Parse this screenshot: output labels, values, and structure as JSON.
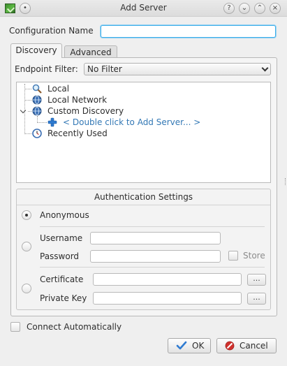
{
  "window": {
    "title": "Add Server",
    "help_symbol": "?",
    "minimize_symbol": "⌄",
    "maximize_symbol": "⌃",
    "close_symbol": "×",
    "pin_symbol": "•"
  },
  "config": {
    "label": "Configuration Name",
    "value": ""
  },
  "tabs": [
    {
      "label": "Discovery",
      "active": true
    },
    {
      "label": "Advanced",
      "active": false
    }
  ],
  "endpoint_filter": {
    "label": "Endpoint Filter:",
    "selected": "No Filter"
  },
  "tree": {
    "items": [
      {
        "label": "Local",
        "icon": "magnifier-icon"
      },
      {
        "label": "Local Network",
        "icon": "network-globe-icon"
      },
      {
        "label": "Custom Discovery",
        "icon": "network-globe-icon",
        "expanded": true
      },
      {
        "label": "< Double click to Add Server... >",
        "icon": "plus-icon"
      },
      {
        "label": "Recently Used",
        "icon": "clock-icon"
      }
    ]
  },
  "auth": {
    "title": "Authentication Settings",
    "anonymous_label": "Anonymous",
    "username_label": "Username",
    "password_label": "Password",
    "store_label": "Store",
    "certificate_label": "Certificate",
    "private_key_label": "Private Key",
    "browse_label": "...",
    "username_value": "",
    "password_value": "",
    "certificate_value": "",
    "private_key_value": "",
    "selected": "anonymous"
  },
  "connect_auto_label": "Connect Automatically",
  "buttons": {
    "ok_label": "OK",
    "cancel_label": "Cancel"
  },
  "colors": {
    "accent": "#3daee9",
    "link": "#3378b5",
    "ok_check": "#2f7bd1",
    "cancel_red": "#d0312d"
  }
}
